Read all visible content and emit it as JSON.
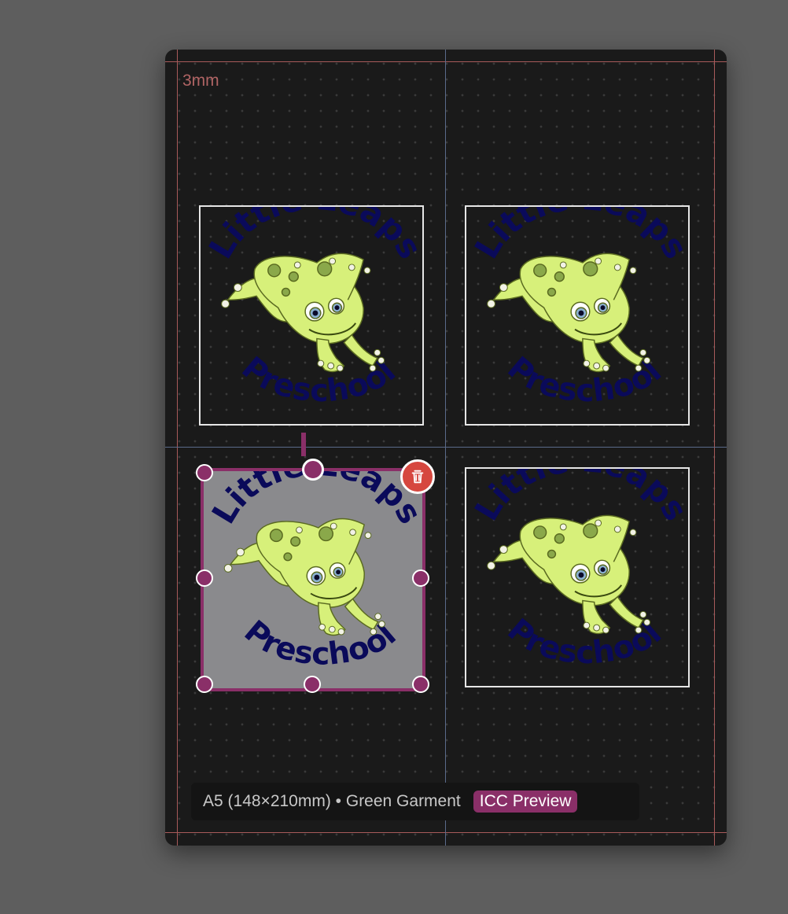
{
  "canvas": {
    "bleed_label": "3mm"
  },
  "tiles": [
    {
      "top_text": "Little Leaps",
      "bottom_text": "Preschool",
      "selected": false
    },
    {
      "top_text": "Little Leaps",
      "bottom_text": "Preschool",
      "selected": false
    },
    {
      "top_text": "Little Leaps",
      "bottom_text": "Preschool",
      "selected": true
    },
    {
      "top_text": "Little Leaps",
      "bottom_text": "Preschool",
      "selected": false
    }
  ],
  "selection": {
    "delete_icon": "trash-icon"
  },
  "status": {
    "info": "A5 (148×210mm) • Green Garment",
    "badge": "ICC Preview"
  },
  "colors": {
    "accent": "#8a2f68",
    "delete": "#d6473f",
    "logo_text": "#0a0a5a",
    "frog_body": "#d7f07a",
    "frog_spots": "#8aa84a"
  }
}
